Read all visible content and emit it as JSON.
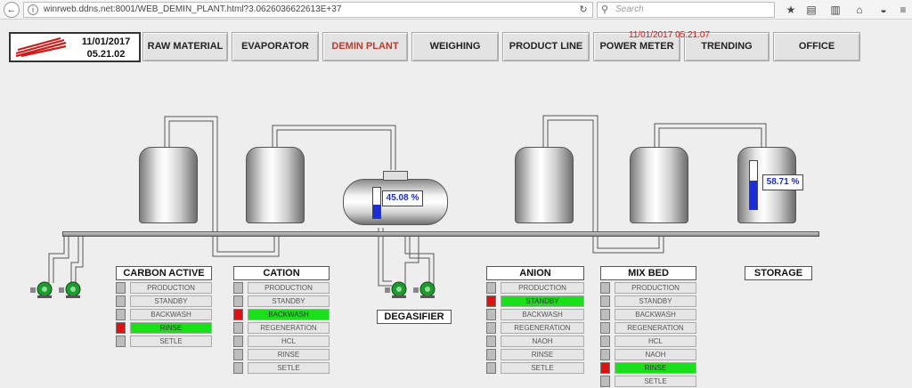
{
  "browser": {
    "url": "winrweb.ddns.net:8001/WEB_DEMIN_PLANT.html?3.0626036622613E+37",
    "search_placeholder": "Search",
    "back_glyph": "←",
    "info_glyph": "i",
    "reload_glyph": "↻",
    "search_glyph": "⚲",
    "toolbar_icons": [
      {
        "name": "star-icon",
        "glyph": "★"
      },
      {
        "name": "reading-list-icon",
        "glyph": "▤"
      },
      {
        "name": "chart-icon",
        "glyph": "▥"
      },
      {
        "name": "home-icon",
        "glyph": "⌂"
      },
      {
        "name": "pocket-icon",
        "glyph": "◒"
      },
      {
        "name": "menu-icon",
        "glyph": "≡"
      }
    ]
  },
  "header": {
    "date": "11/01/2017",
    "time": "05.21.02",
    "server_timestamp": "11/01/2017 05.21.07",
    "nav": [
      {
        "label": "RAW MATERIAL",
        "active": false
      },
      {
        "label": "EVAPORATOR",
        "active": false
      },
      {
        "label": "DEMIN PLANT",
        "active": true
      },
      {
        "label": "WEIGHING",
        "active": false
      },
      {
        "label": "PRODUCT LINE",
        "active": false
      },
      {
        "label": "POWER METER",
        "active": false
      },
      {
        "label": "TRENDING",
        "active": false
      },
      {
        "label": "OFFICE",
        "active": false
      }
    ]
  },
  "levels": {
    "degasifier_pct": "45.08 %",
    "degasifier_fraction": 0.4508,
    "storage_pct": "58.71 %",
    "storage_fraction": 0.5871
  },
  "sections": {
    "carbon_active": {
      "title": "CARBON ACTIVE",
      "rows": [
        {
          "label": "PRODUCTION",
          "sq": "gray",
          "active": false
        },
        {
          "label": "STANDBY",
          "sq": "gray",
          "active": false
        },
        {
          "label": "BACKWASH",
          "sq": "gray",
          "active": false
        },
        {
          "label": "RINSE",
          "sq": "red",
          "active": true
        },
        {
          "label": "SETLE",
          "sq": "gray",
          "active": false
        }
      ]
    },
    "cation": {
      "title": "CATION",
      "rows": [
        {
          "label": "PRODUCTION",
          "sq": "gray",
          "active": false
        },
        {
          "label": "STANDBY",
          "sq": "gray",
          "active": false
        },
        {
          "label": "BACKWASH",
          "sq": "red",
          "active": true
        },
        {
          "label": "REGENERATION",
          "sq": "gray",
          "active": false
        },
        {
          "label": "HCL",
          "sq": "gray",
          "active": false
        },
        {
          "label": "RINSE",
          "sq": "gray",
          "active": false
        },
        {
          "label": "SETLE",
          "sq": "gray",
          "active": false
        }
      ]
    },
    "anion": {
      "title": "ANION",
      "rows": [
        {
          "label": "PRODUCTION",
          "sq": "gray",
          "active": false
        },
        {
          "label": "STANDBY",
          "sq": "red",
          "active": true
        },
        {
          "label": "BACKWASH",
          "sq": "gray",
          "active": false
        },
        {
          "label": "REGENERATION",
          "sq": "gray",
          "active": false
        },
        {
          "label": "NAOH",
          "sq": "gray",
          "active": false
        },
        {
          "label": "RINSE",
          "sq": "gray",
          "active": false
        },
        {
          "label": "SETLE",
          "sq": "gray",
          "active": false
        }
      ]
    },
    "mixbed": {
      "title": "MIX BED",
      "rows": [
        {
          "label": "PRODUCTION",
          "sq": "gray",
          "active": false
        },
        {
          "label": "STANDBY",
          "sq": "gray",
          "active": false
        },
        {
          "label": "BACKWASH",
          "sq": "gray",
          "active": false
        },
        {
          "label": "REGENERATION",
          "sq": "gray",
          "active": false
        },
        {
          "label": "HCL",
          "sq": "gray",
          "active": false
        },
        {
          "label": "NAOH",
          "sq": "gray",
          "active": false
        },
        {
          "label": "RINSE",
          "sq": "red",
          "active": true
        },
        {
          "label": "SETLE",
          "sq": "gray",
          "active": false
        }
      ]
    },
    "degasifier": {
      "title": "DEGASIFIER"
    },
    "storage": {
      "title": "STORAGE"
    }
  },
  "colors": {
    "active_green": "#19e019",
    "alarm_red": "#e01010",
    "level_blue": "#1a2dd8"
  }
}
